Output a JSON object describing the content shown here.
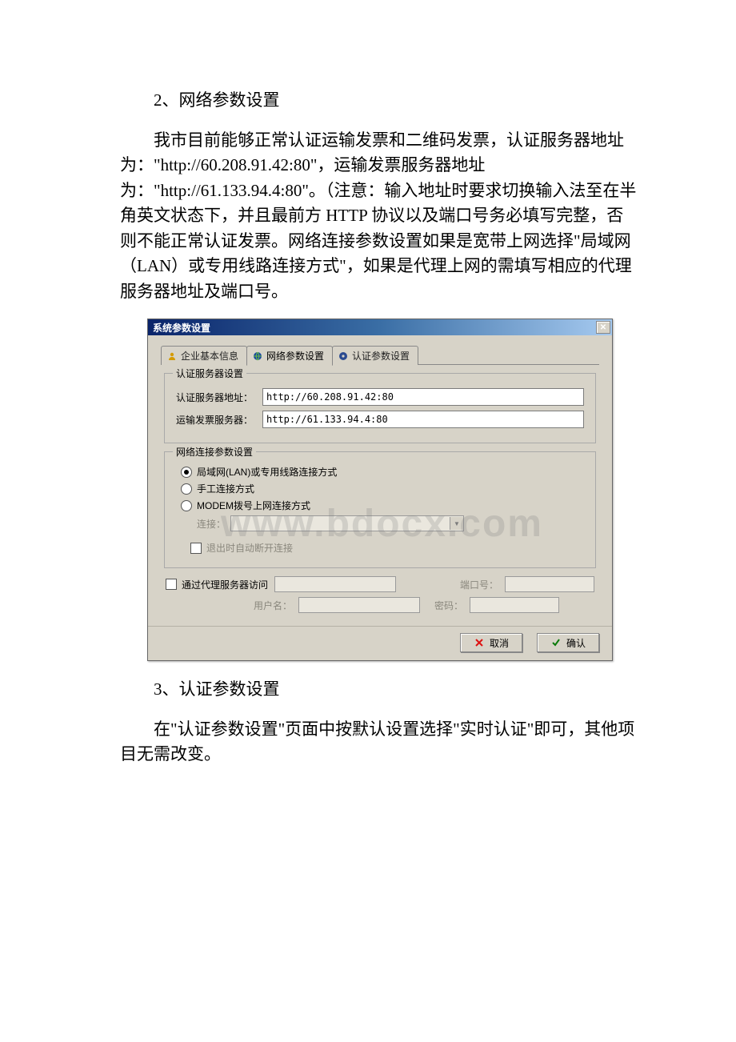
{
  "doc": {
    "section2_title": "2、网络参数设置",
    "section2_body": "我市目前能够正常认证运输发票和二维码发票，认证服务器地址为：\"http://60.208.91.42:80\"，运输发票服务器地址为：\"http://61.133.94.4:80\"。（注意：输入地址时要求切换输入法至在半角英文状态下，并且最前方 HTTP 协议以及端口号务必填写完整，否则不能正常认证发票。网络连接参数设置如果是宽带上网选择\"局域网（LAN）或专用线路连接方式\"，如果是代理上网的需填写相应的代理服务器地址及端口号。",
    "section3_title": "3、认证参数设置",
    "section3_body": "在\"认证参数设置\"页面中按默认设置选择\"实时认证\"即可，其他项目无需改变。"
  },
  "dialog": {
    "title": "系统参数设置",
    "tabs": {
      "t1": "企业基本信息",
      "t2": "网络参数设置",
      "t3": "认证参数设置"
    },
    "group1": {
      "legend": "认证服务器设置",
      "lbl_auth": "认证服务器地址：",
      "val_auth": "http://60.208.91.42:80",
      "lbl_trans": "运输发票服务器：",
      "val_trans": "http://61.133.94.4:80"
    },
    "group2": {
      "legend": "网络连接参数设置",
      "radio_lan": "局域网(LAN)或专用线路连接方式",
      "radio_manual": "手工连接方式",
      "radio_modem": "MODEM拨号上网连接方式",
      "conn_lbl": "连接：",
      "chk_exit": "退出时自动断开连接"
    },
    "proxy": {
      "chk_label": "通过代理服务器访问",
      "port_lbl": "端口号：",
      "user_lbl": "用户名：",
      "pass_lbl": "密码："
    },
    "buttons": {
      "cancel": "取消",
      "ok": "确认"
    }
  },
  "watermark": "www.bdocx.com"
}
